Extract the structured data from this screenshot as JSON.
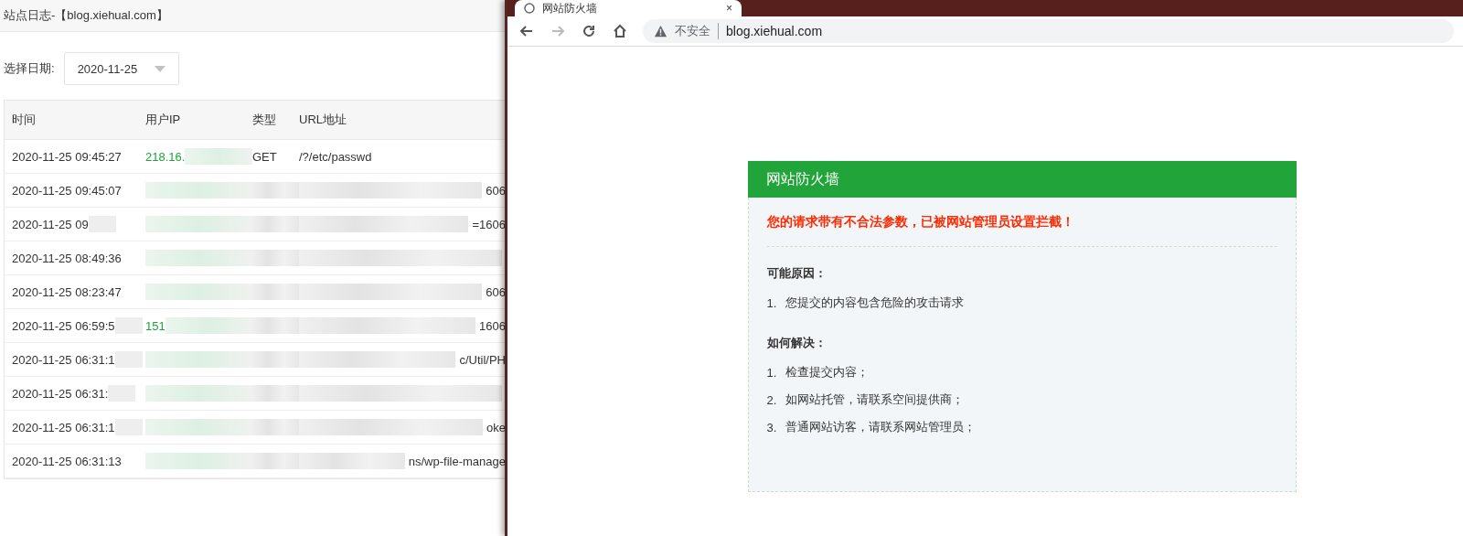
{
  "log_panel": {
    "title": "站点日志-【blog.xiehual.com】",
    "date_label": "选择日期:",
    "date_select": {
      "value": "2020-11-25"
    },
    "table": {
      "columns": [
        "时间",
        "用户IP",
        "类型",
        "URL地址"
      ],
      "rows": [
        {
          "time": {
            "text": "2020-11-25 09:45:27",
            "masked": false
          },
          "ip": {
            "text": "218.16.",
            "masked": true
          },
          "type": {
            "text": "GET",
            "masked": false
          },
          "url": {
            "text": "/?/etc/passwd",
            "masked": false
          }
        },
        {
          "time": {
            "text": "2020-11-25 09:45:07",
            "masked": false
          },
          "ip": {
            "masked": true
          },
          "type": {
            "masked": true
          },
          "url": {
            "text": "606",
            "masked": true
          }
        },
        {
          "time": {
            "text": "2020-11-25 09",
            "masked": true
          },
          "ip": {
            "masked": true
          },
          "type": {
            "masked": true
          },
          "url": {
            "text": "=1606",
            "masked": true
          }
        },
        {
          "time": {
            "text": "2020-11-25 08:49:36",
            "masked": false
          },
          "ip": {
            "masked": true
          },
          "type": {
            "masked": true
          },
          "url": {
            "masked": true
          }
        },
        {
          "time": {
            "text": "2020-11-25 08:23:47",
            "masked": false
          },
          "ip": {
            "masked": true
          },
          "type": {
            "masked": true
          },
          "url": {
            "text": "606",
            "masked": true
          }
        },
        {
          "time": {
            "text": "2020-11-25 06:59:5",
            "masked": true
          },
          "ip": {
            "text": "151",
            "masked": true
          },
          "type": {
            "masked": true
          },
          "url": {
            "text": "1606",
            "masked": true
          }
        },
        {
          "time": {
            "text": "2020-11-25 06:31:1",
            "masked": true
          },
          "ip": {
            "masked": true
          },
          "type": {
            "masked": true
          },
          "url": {
            "text": "c/Util/PH",
            "masked": true
          }
        },
        {
          "time": {
            "text": "2020-11-25 06:31:",
            "masked": true
          },
          "ip": {
            "masked": true
          },
          "type": {
            "masked": true
          },
          "url": {
            "masked": true
          }
        },
        {
          "time": {
            "text": "2020-11-25 06:31:1",
            "masked": true
          },
          "ip": {
            "masked": true
          },
          "type": {
            "masked": true
          },
          "url": {
            "text": "oke",
            "masked": true
          }
        },
        {
          "time": {
            "text": "2020-11-25 06:31:13",
            "masked": false
          },
          "ip": {
            "masked": true
          },
          "type": {
            "masked": true
          },
          "url": {
            "text": "ns/wp-file-manage",
            "masked": true
          }
        }
      ]
    }
  },
  "browser": {
    "tab": {
      "title": "网站防火墙",
      "close": "×",
      "selected": true
    },
    "nav": {
      "back_disabled": false,
      "forward_disabled": true
    },
    "address": {
      "security": "不安全",
      "url": "blog.xiehual.com"
    },
    "page": {
      "card_title": "网站防火墙",
      "alert": "您的请求带有不合法参数，已被网站管理员设置拦截！",
      "sections": [
        {
          "heading": "可能原因：",
          "items": [
            {
              "num": "1.",
              "text": "您提交的内容包含危险的攻击请求"
            }
          ]
        },
        {
          "heading": "如何解决：",
          "items": [
            {
              "num": "1.",
              "text": "检查提交内容；"
            },
            {
              "num": "2.",
              "text": "如网站托管，请联系空间提供商；"
            },
            {
              "num": "3.",
              "text": "普通网站访客，请联系网站管理员；"
            }
          ]
        }
      ]
    }
  }
}
